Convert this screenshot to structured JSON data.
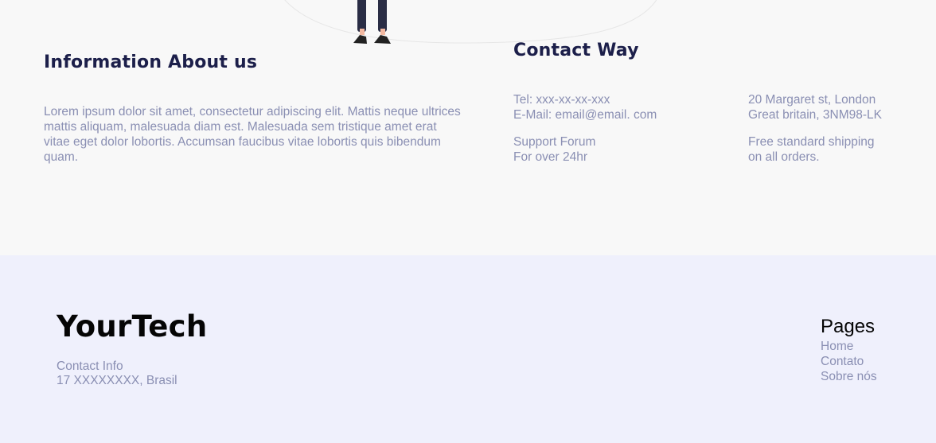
{
  "about": {
    "title": "Information About us",
    "text": "Lorem ipsum dolor sit amet, consectetur adipiscing elit. Mattis neque ultrices mattis aliquam, malesuada diam est. Malesuada sem tristique amet erat vitae eget dolor lobortis. Accumsan faucibus vitae lobortis quis bibendum quam."
  },
  "contact": {
    "title": "Contact Way",
    "tel": "Tel: xxx-xx-xx-xxx",
    "email": "E-Mail: email@email. com",
    "support_1": "Support Forum",
    "support_2": "For over 24hr",
    "address_1": "20 Margaret st, London",
    "address_2": "Great britain, 3NM98-LK",
    "shipping_1": "Free standard shipping",
    "shipping_2": "on all orders."
  },
  "footer": {
    "brand": "YourTech",
    "contact_info_label": "Contact Info",
    "contact_info_value": "17 XXXXXXXX, Brasil",
    "pages_title": "Pages",
    "pages": [
      "Home",
      "Contato",
      "Sobre nós"
    ]
  }
}
